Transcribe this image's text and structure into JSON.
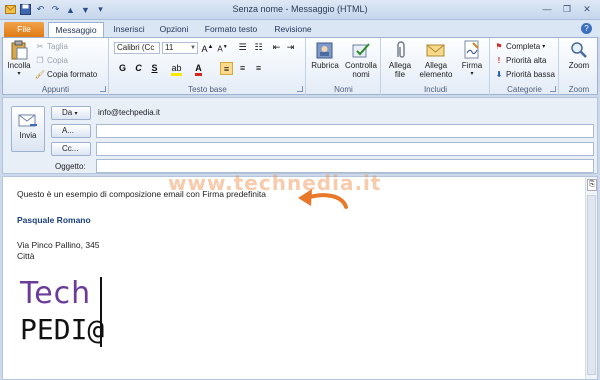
{
  "window": {
    "title": "Senza nome  -  Messaggio (HTML)"
  },
  "tabs": [
    "File",
    "Messaggio",
    "Inserisci",
    "Opzioni",
    "Formato testo",
    "Revisione"
  ],
  "ribbon": {
    "appunti": {
      "label": "Appunti",
      "paste": "Incolla",
      "cut": "Taglia",
      "copy": "Copia",
      "format_painter": "Copia formato"
    },
    "testo_base": {
      "label": "Testo base",
      "font": "Calibri (Cc",
      "size": "11",
      "bold": "G",
      "italic": "C",
      "underline": "S"
    },
    "nomi": {
      "label": "Nomi",
      "address_book": "Rubrica",
      "check_names": "Controlla nomi"
    },
    "includi": {
      "label": "Includi",
      "attach_file": "Allega file",
      "attach_item": "Allega elemento",
      "signature": "Firma"
    },
    "categorie": {
      "label": "Categorie",
      "follow_up": "Completa",
      "high": "Priorità alta",
      "low": "Priorità bassa"
    },
    "zoom": {
      "label": "Zoom",
      "zoom": "Zoom"
    }
  },
  "header": {
    "send": "Invia",
    "from_btn": "Da",
    "from_value": "info@techpedia.it",
    "to_btn": "A...",
    "cc_btn": "Cc...",
    "subject_label": "Oggetto:"
  },
  "body": {
    "line1": "Questo è un esempio di composizione email con Firma predefinita",
    "name": "Pasquale Romano",
    "address": "Via Pinco Pallino, 345",
    "city": "Città",
    "logo_top": "Tech",
    "logo_bottom": "PEDI@"
  },
  "watermark": "www.technedia.it",
  "colors": {
    "file_tab": "#e07a14",
    "accent": "#1b3f7a",
    "logo_purple": "#6b3b9a",
    "arrow": "#e8782a"
  }
}
